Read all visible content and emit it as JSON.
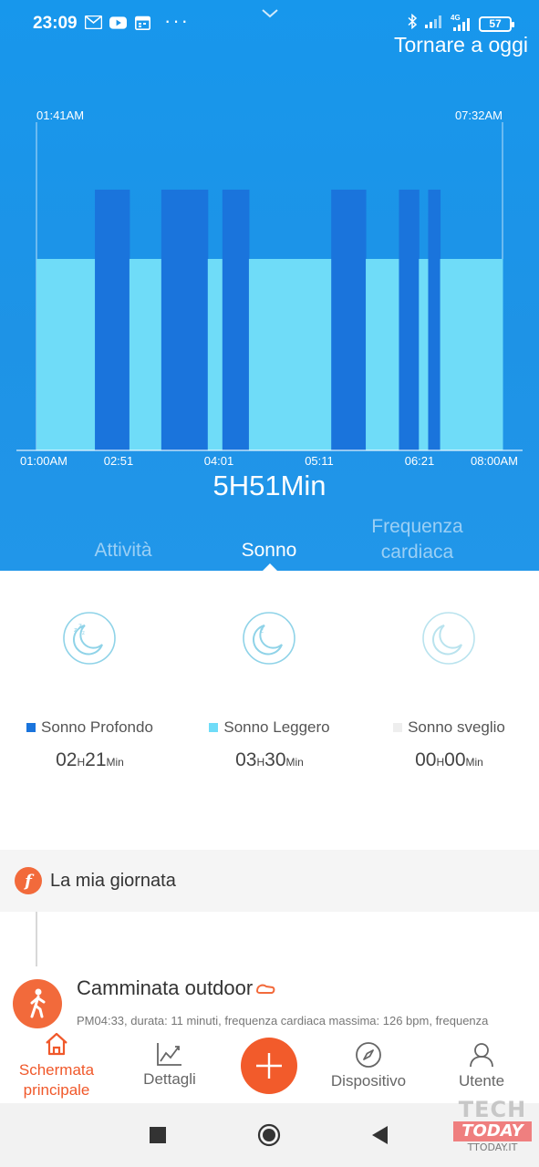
{
  "status_bar": {
    "time": "23:09",
    "left_icons": [
      "gmail-icon",
      "youtube-icon",
      "calendar-icon"
    ],
    "more": "···",
    "network_label": "4G",
    "battery": "57"
  },
  "header": {
    "back_to_today": "Tornare a oggi"
  },
  "chart_data": {
    "type": "bar",
    "start_label": "01:41AM",
    "end_label": "07:32AM",
    "x_ticks": [
      "01:00AM",
      "02:51",
      "04:01",
      "05:11",
      "06:21",
      "08:00AM"
    ],
    "segments": [
      {
        "stage": "light",
        "start": "01:41",
        "end": "02:25"
      },
      {
        "stage": "deep",
        "start": "02:25",
        "end": "02:51"
      },
      {
        "stage": "light",
        "start": "02:51",
        "end": "03:15"
      },
      {
        "stage": "deep",
        "start": "03:15",
        "end": "03:50"
      },
      {
        "stage": "light",
        "start": "03:50",
        "end": "04:01"
      },
      {
        "stage": "deep",
        "start": "04:01",
        "end": "04:21"
      },
      {
        "stage": "light",
        "start": "04:21",
        "end": "05:23"
      },
      {
        "stage": "deep",
        "start": "05:23",
        "end": "05:49"
      },
      {
        "stage": "light",
        "start": "05:49",
        "end": "06:14"
      },
      {
        "stage": "deep",
        "start": "06:14",
        "end": "06:29"
      },
      {
        "stage": "light",
        "start": "06:29",
        "end": "06:36"
      },
      {
        "stage": "deep",
        "start": "06:36",
        "end": "06:45"
      },
      {
        "stage": "light",
        "start": "06:45",
        "end": "07:32"
      }
    ],
    "colors": {
      "deep": "#1a74dc",
      "light": "#6fdcf8"
    }
  },
  "summary": {
    "duration": "5H51Min"
  },
  "tabs": [
    {
      "label": "Attività",
      "active": false
    },
    {
      "label": "Sonno",
      "active": true
    },
    {
      "label": "Frequenza cardiaca",
      "active": false
    }
  ],
  "stats": [
    {
      "icon": "deep-sleep-moon-icon",
      "label": "Sonno Profondo",
      "color": "#1a74dc",
      "hours": "02",
      "h_unit": "H",
      "minutes": "21",
      "m_unit": "Min"
    },
    {
      "icon": "light-sleep-moon-icon",
      "label": "Sonno Leggero",
      "color": "#6fdcf8",
      "hours": "03",
      "h_unit": "H",
      "minutes": "30",
      "m_unit": "Min"
    },
    {
      "icon": "awake-moon-icon",
      "label": "Sonno sveglio",
      "color": "#eeeeee",
      "hours": "00",
      "h_unit": "H",
      "minutes": "00",
      "m_unit": "Min"
    }
  ],
  "my_day": {
    "logo_letter": "f",
    "title": "La mia giornata",
    "activity": {
      "title": "Camminata outdoor",
      "description": "PM04:33, durata: 11 minuti, frequenza cardiaca massima: 126 bpm, frequenza"
    }
  },
  "bottom_nav": {
    "home_line1": "Schermata",
    "home_line2": "principale",
    "details": "Dettagli",
    "device": "Dispositivo",
    "user": "Utente"
  },
  "watermark": {
    "tech": "TECH",
    "today": "TODAY",
    "domain": "TTODAY.IT"
  }
}
